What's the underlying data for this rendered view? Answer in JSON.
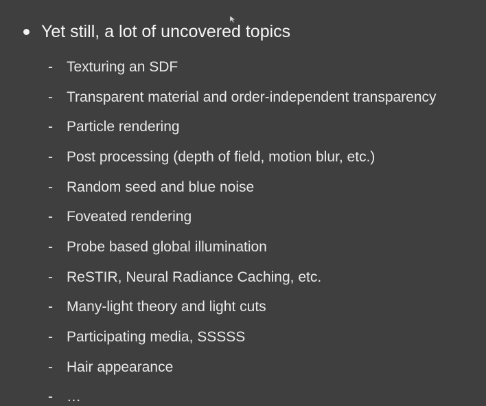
{
  "slide": {
    "main_bullet": "Yet still, a lot of uncovered topics",
    "sub_items": [
      "Texturing an SDF",
      "Transparent material and order-independent transparency",
      "Particle rendering",
      "Post processing (depth of field, motion blur, etc.)",
      "Random seed and blue noise",
      "Foveated rendering",
      "Probe based global illumination",
      "ReSTIR, Neural Radiance Caching, etc.",
      "Many-light theory and light cuts",
      "Participating media, SSSSS",
      "Hair appearance",
      "…"
    ],
    "dash": "-"
  },
  "colors": {
    "background": "#3f3f3f",
    "text": "#e9e9e9"
  },
  "icons": {
    "cursor": "mouse-pointer-icon"
  }
}
